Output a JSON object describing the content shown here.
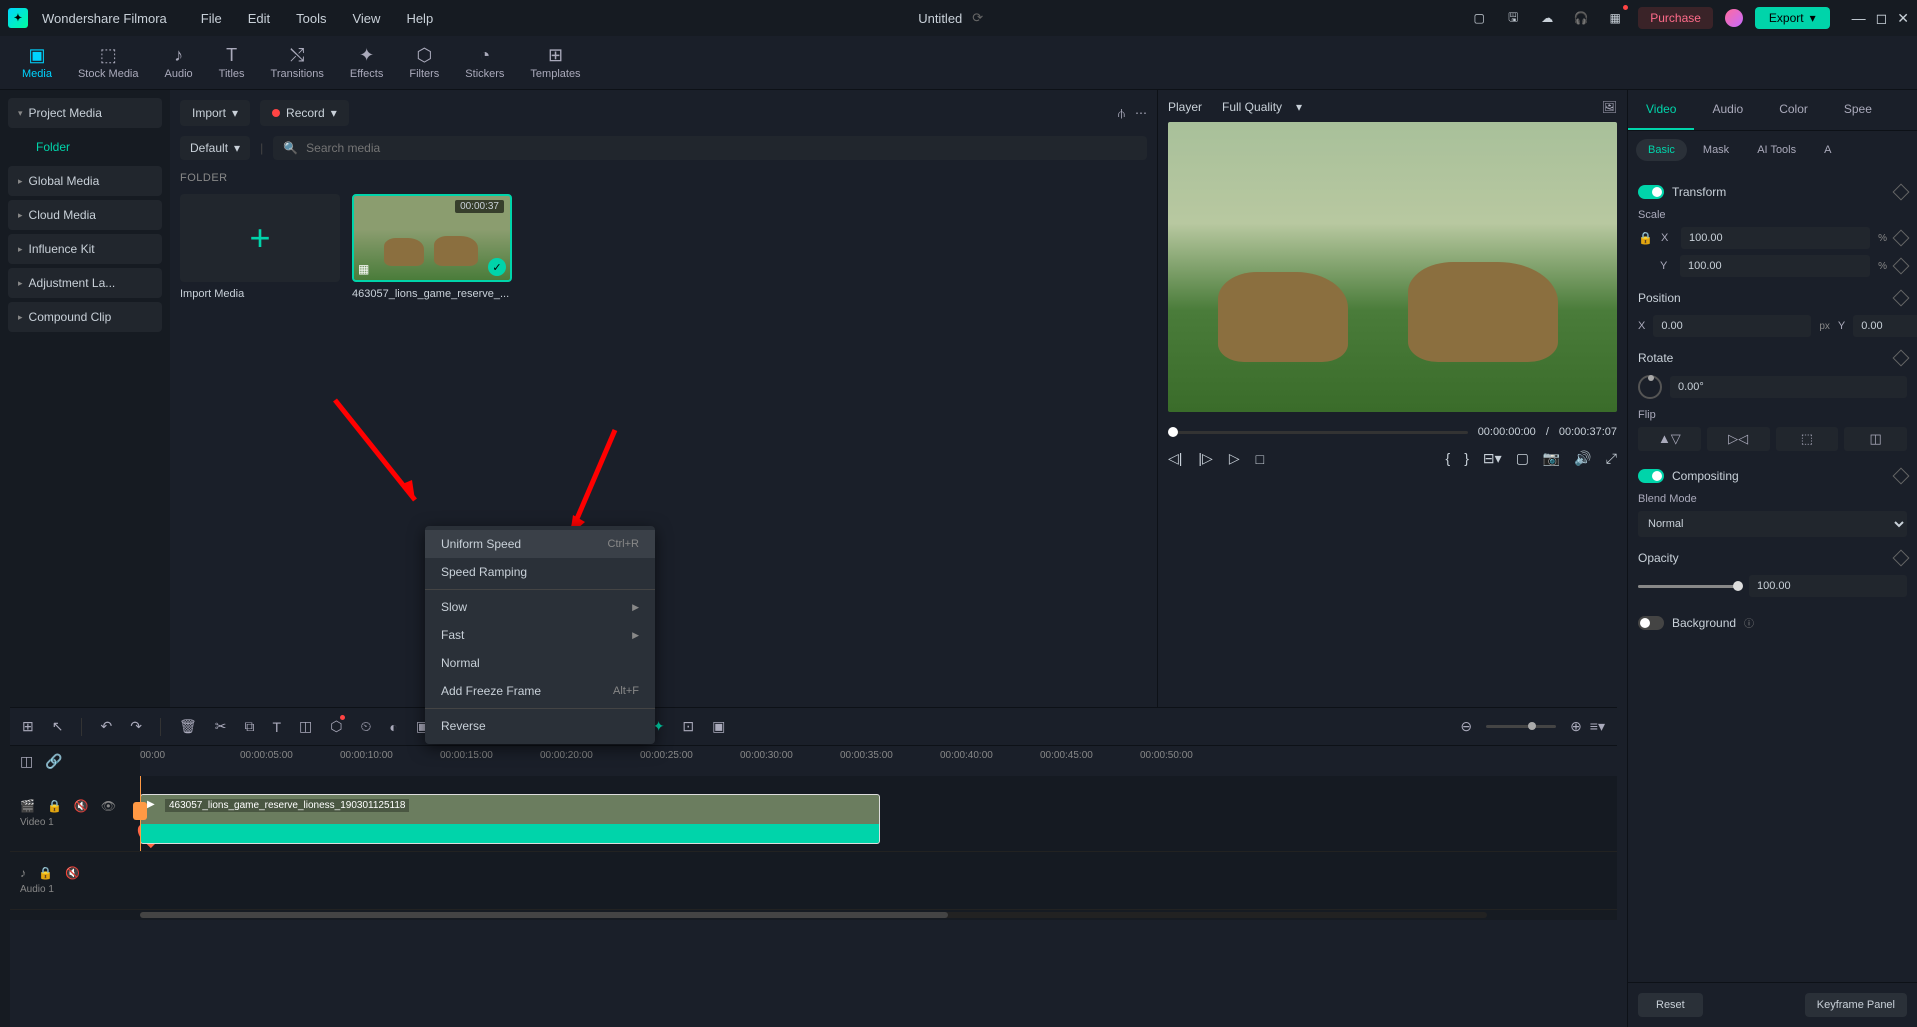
{
  "app": {
    "title": "Wondershare Filmora"
  },
  "menu": {
    "file": "File",
    "edit": "Edit",
    "tools": "Tools",
    "view": "View",
    "help": "Help"
  },
  "doc": {
    "title": "Untitled"
  },
  "titlebar": {
    "purchase": "Purchase",
    "export": "Export"
  },
  "tabs": {
    "media": "Media",
    "stock": "Stock Media",
    "audio": "Audio",
    "titles": "Titles",
    "transitions": "Transitions",
    "effects": "Effects",
    "filters": "Filters",
    "stickers": "Stickers",
    "templates": "Templates"
  },
  "sidebar": {
    "project": "Project Media",
    "folder": "Folder",
    "global": "Global Media",
    "cloud": "Cloud Media",
    "influence": "Influence Kit",
    "adjust": "Adjustment La...",
    "compound": "Compound Clip"
  },
  "mediaPanel": {
    "import": "Import",
    "record": "Record",
    "default": "Default",
    "searchPlaceholder": "Search media",
    "folderLabel": "FOLDER",
    "importMedia": "Import Media",
    "clip1": {
      "caption": "463057_lions_game_reserve_...",
      "duration": "00:00:37"
    }
  },
  "player": {
    "label": "Player",
    "quality": "Full Quality",
    "timeCurrent": "00:00:00:00",
    "sep": "/",
    "timeTotal": "00:00:37:07"
  },
  "inspector": {
    "tabs": {
      "video": "Video",
      "audio": "Audio",
      "color": "Color",
      "speed": "Spee"
    },
    "subtabs": {
      "basic": "Basic",
      "mask": "Mask",
      "ai": "AI Tools",
      "an": "A"
    },
    "transform": "Transform",
    "scale": "Scale",
    "scaleX": "100.00",
    "scaleY": "100.00",
    "pct": "%",
    "position": "Position",
    "posX": "0.00",
    "posY": "0.00",
    "px": "px",
    "rotate": "Rotate",
    "rotateVal": "0.00°",
    "flip": "Flip",
    "compositing": "Compositing",
    "blendMode": "Blend Mode",
    "blendVal": "Normal",
    "opacity": "Opacity",
    "opacityVal": "100.00",
    "background": "Background",
    "reset": "Reset",
    "keyframe": "Keyframe Panel",
    "axisX": "X",
    "axisY": "Y"
  },
  "timeline": {
    "ticks": [
      "00:00",
      "00:00:05:00",
      "00:00:10:00",
      "00:00:15:00",
      "00:00:20:00",
      "00:00:25:00",
      "00:00:30:00",
      "00:00:35:00",
      "00:00:40:00",
      "00:00:45:00",
      "00:00:50:00"
    ],
    "video1": "Video 1",
    "audio1": "Audio 1",
    "clipName": "463057_lions_game_reserve_lioness_190301125118"
  },
  "ctx": {
    "uniformSpeed": "Uniform Speed",
    "uniformSpeedKey": "Ctrl+R",
    "speedRamping": "Speed Ramping",
    "slow": "Slow",
    "fast": "Fast",
    "normal": "Normal",
    "freeze": "Add Freeze Frame",
    "freezeKey": "Alt+F",
    "reverse": "Reverse"
  }
}
